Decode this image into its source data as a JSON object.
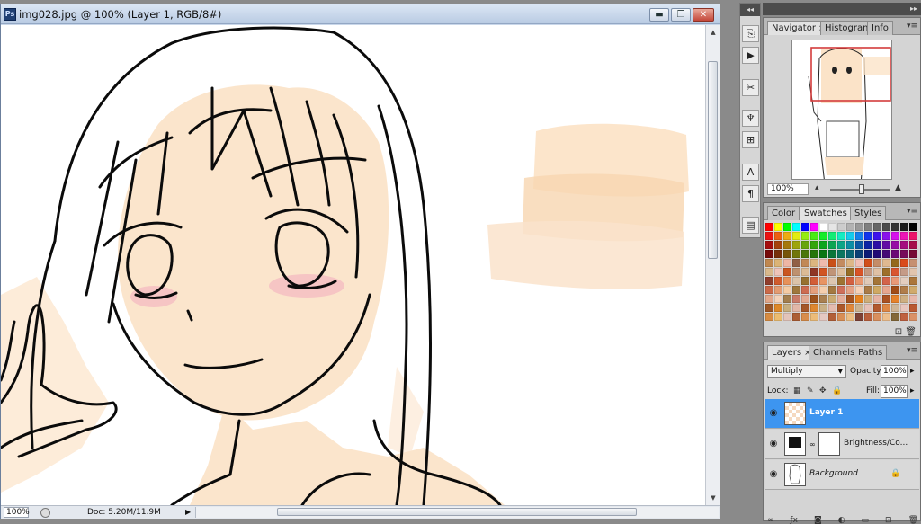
{
  "window": {
    "title": "img028.jpg @ 100% (Layer 1, RGB/8#)",
    "app_icon": "Ps",
    "buttons": {
      "minimize": "▬",
      "restore": "❐",
      "close": "✕"
    }
  },
  "status": {
    "zoom": "100%",
    "doc": "Doc: 5.20M/11.9M"
  },
  "dock": {
    "collapse": "◂◂",
    "expand": "▸▸"
  },
  "tools": [
    {
      "name": "history-icon",
      "glyph": "⎘"
    },
    {
      "name": "actions-icon",
      "glyph": "▶"
    },
    {
      "name": "brushes-icon",
      "glyph": "✂"
    },
    {
      "name": "clone-source-icon",
      "glyph": "♆"
    },
    {
      "name": "tool-presets-icon",
      "glyph": "⊞"
    },
    {
      "name": "character-icon",
      "glyph": "A"
    },
    {
      "name": "paragraph-icon",
      "glyph": "¶"
    },
    {
      "name": "layer-comps-icon",
      "glyph": "▤"
    }
  ],
  "navigator_panel": {
    "tabs": [
      "Navigator",
      "Histogram",
      "Info"
    ],
    "zoom": "100%"
  },
  "swatches_panel": {
    "tabs": [
      "Color",
      "Swatches",
      "Styles"
    ]
  },
  "layers_panel": {
    "tabs": [
      "Layers",
      "Channels",
      "Paths"
    ],
    "blend_mode": "Multiply",
    "opacity_label": "Opacity:",
    "opacity": "100%",
    "lock_label": "Lock:",
    "fill_label": "Fill:",
    "fill": "100%",
    "layers": [
      {
        "name": "Layer 1",
        "selected": true
      },
      {
        "name": "Brightness/Co...",
        "selected": false
      },
      {
        "name": "Background",
        "selected": false
      }
    ]
  },
  "colors": {
    "skin": "#fbe3c8",
    "skin_light": "#fdecd9",
    "blush": "#f4b9c2",
    "line": "#0b0b0b",
    "selection": "#3d95f0",
    "nav_frame": "#d43c3c"
  }
}
